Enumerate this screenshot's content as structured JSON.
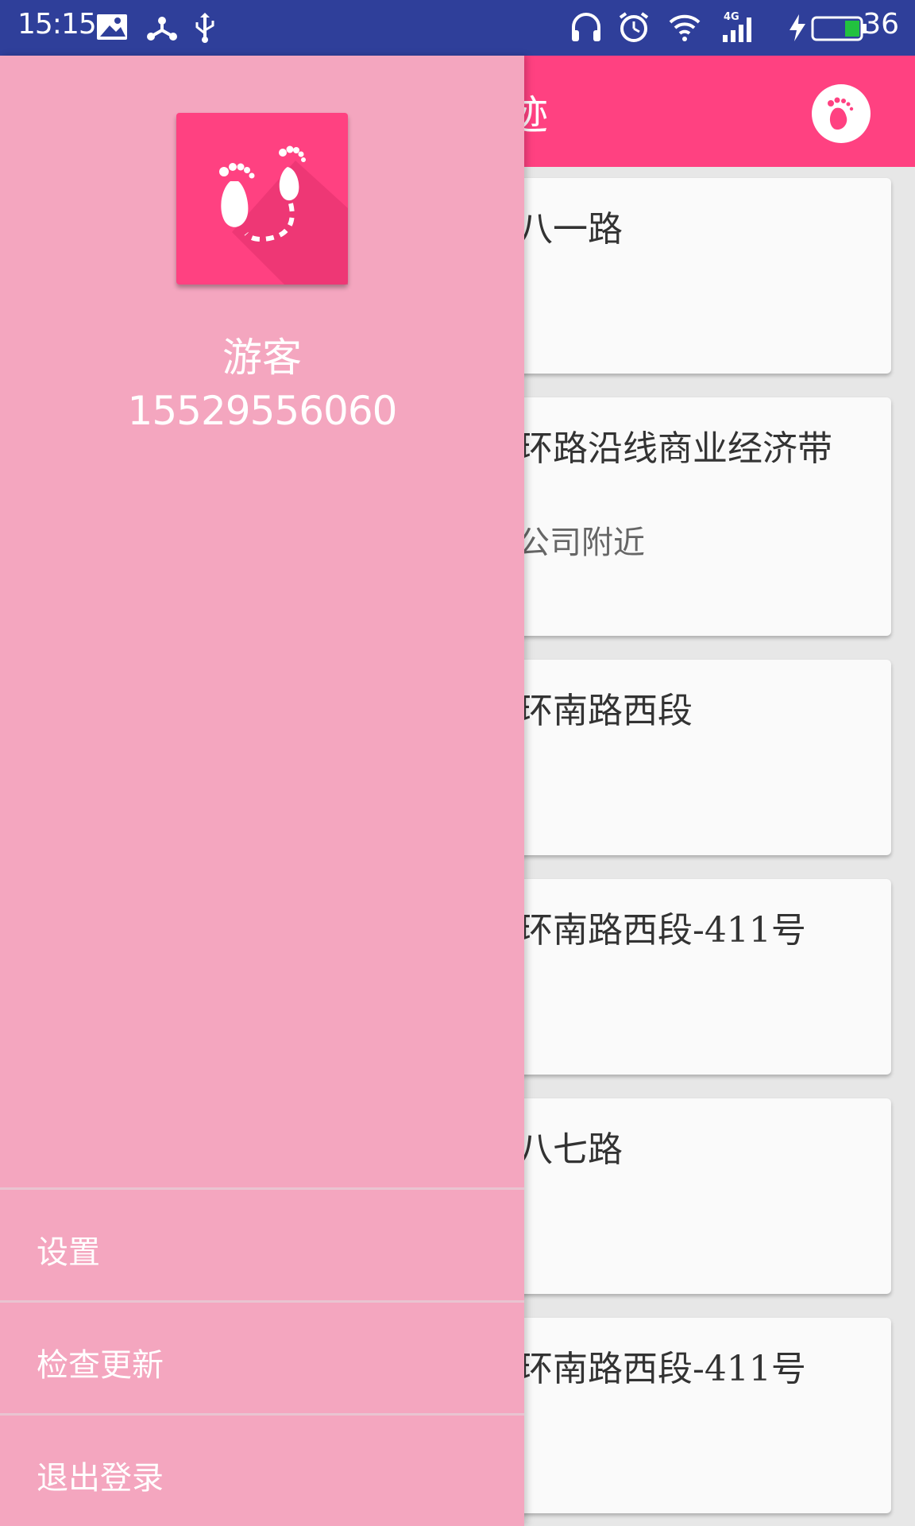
{
  "status_bar": {
    "time": "15:15",
    "network": "4G",
    "battery": "36",
    "icons": [
      "gallery-icon",
      "share-icon",
      "usb-icon",
      "headphones-icon",
      "alarm-icon",
      "wifi-icon",
      "signal-icon",
      "charging-icon",
      "battery-icon"
    ]
  },
  "app_bar": {
    "title": "迹",
    "action_icon": "footprints-icon",
    "color": "#ff4181"
  },
  "cards": [
    {
      "title": "八一路",
      "subtitle": ""
    },
    {
      "title": "环路沿线商业经济带",
      "subtitle": "公司附近"
    },
    {
      "title": "环南路西段",
      "subtitle": ""
    },
    {
      "title": "环南路西段-411号",
      "subtitle": ""
    },
    {
      "title": "八七路",
      "subtitle": ""
    },
    {
      "title": "环南路西段-411号",
      "subtitle": ""
    }
  ],
  "drawer": {
    "logo_icon": "footprints-logo-icon",
    "user_name": "游客",
    "phone": "15529556060",
    "menu": [
      {
        "label": "设置"
      },
      {
        "label": "检查更新"
      },
      {
        "label": "退出登录"
      }
    ],
    "background": "#f4a6bf"
  }
}
